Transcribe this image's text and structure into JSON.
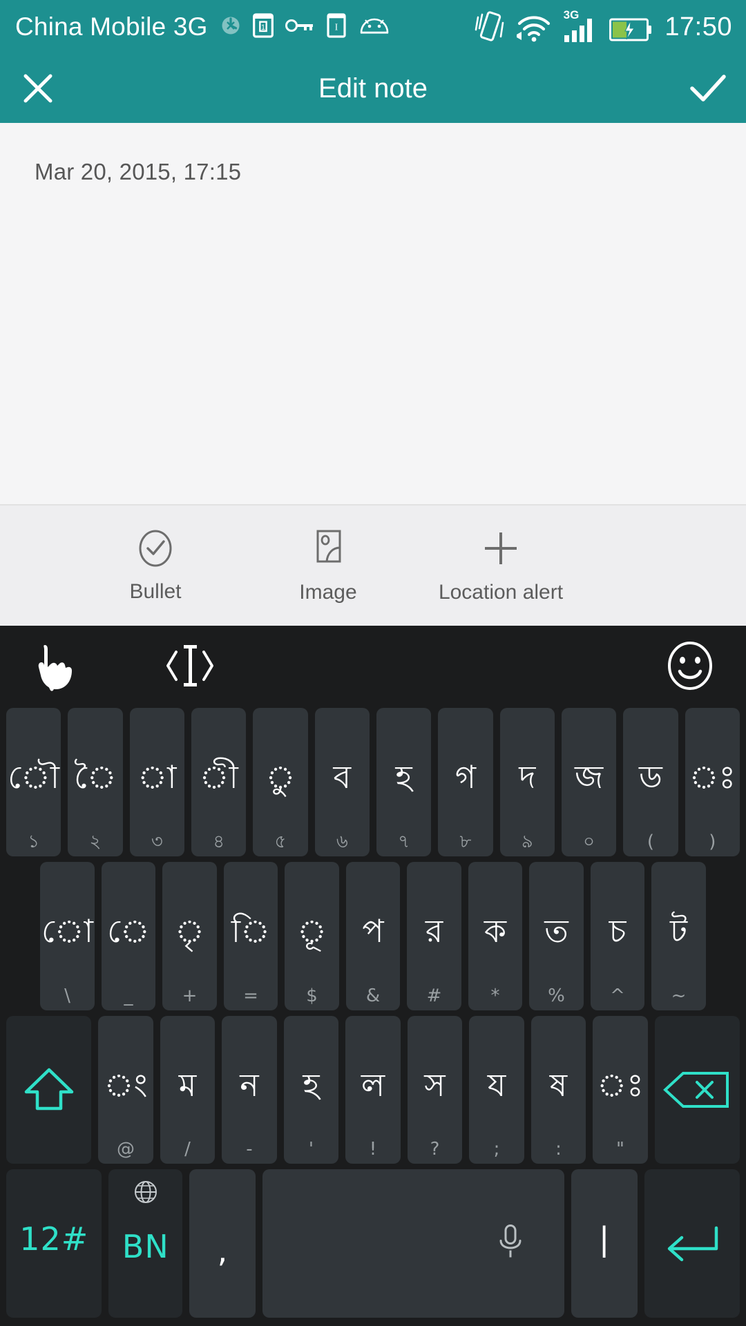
{
  "statusbar": {
    "carrier": "China Mobile 3G",
    "network_type": "3G",
    "time": "17:50",
    "icons": [
      "dnd-icon",
      "sim-card-1-icon",
      "vpn-key-icon",
      "sd-card-icon",
      "android-robot-icon",
      "vibrate-icon",
      "wifi-icon",
      "signal-bars-icon",
      "battery-charging-icon"
    ]
  },
  "appbar": {
    "title": "Edit note",
    "close_label": "✕",
    "save_label": "✓"
  },
  "note": {
    "timestamp": "Mar 20, 2015, 17:15",
    "body_text": "",
    "body_placeholder": ""
  },
  "action_bar": {
    "items": [
      {
        "label": "Bullet",
        "icon": "check-circle-icon"
      },
      {
        "label": "Image",
        "icon": "photo-icon"
      },
      {
        "label": "Location alert",
        "icon": "plus-icon"
      }
    ]
  },
  "keyboard": {
    "language": "BN",
    "accent_color": "#2fe0c8",
    "toolbar": [
      {
        "icon": "handwriting-icon"
      },
      {
        "icon": "cursor-move-icon"
      },
      {
        "icon": "emoji-icon"
      }
    ],
    "rows": [
      [
        {
          "main": "ৌ",
          "sub": "১"
        },
        {
          "main": "ৈ",
          "sub": "২"
        },
        {
          "main": "া",
          "sub": "৩"
        },
        {
          "main": "ী",
          "sub": "৪"
        },
        {
          "main": "ু",
          "sub": "৫"
        },
        {
          "main": "ব",
          "sub": "৬"
        },
        {
          "main": "হ",
          "sub": "৭"
        },
        {
          "main": "গ",
          "sub": "৮"
        },
        {
          "main": "দ",
          "sub": "৯"
        },
        {
          "main": "জ",
          "sub": "০"
        },
        {
          "main": "ড",
          "sub": "("
        },
        {
          "main": "ঃ",
          "sub": ")"
        }
      ],
      [
        {
          "main": "ো",
          "sub": "\\"
        },
        {
          "main": "ে",
          "sub": "_"
        },
        {
          "main": "ৃ",
          "sub": "+"
        },
        {
          "main": "ি",
          "sub": "="
        },
        {
          "main": "ূ",
          "sub": "$"
        },
        {
          "main": "প",
          "sub": "&"
        },
        {
          "main": "র",
          "sub": "#"
        },
        {
          "main": "ক",
          "sub": "*"
        },
        {
          "main": "ত",
          "sub": "%"
        },
        {
          "main": "চ",
          "sub": "^"
        },
        {
          "main": "ট",
          "sub": "~"
        }
      ],
      [
        {
          "main": "ং",
          "sub": "@"
        },
        {
          "main": "ম",
          "sub": "/"
        },
        {
          "main": "ন",
          "sub": "-"
        },
        {
          "main": "হ",
          "sub": "'"
        },
        {
          "main": "ল",
          "sub": "!"
        },
        {
          "main": "স",
          "sub": "?"
        },
        {
          "main": "য",
          "sub": ";"
        },
        {
          "main": "ষ",
          "sub": ":"
        },
        {
          "main": "ঃ",
          "sub": "\""
        }
      ],
      [
        {
          "main": "12#",
          "name": "symbols-key"
        },
        {
          "main": "BN",
          "name": "language-key"
        },
        {
          "main": ",",
          "name": "comma-key"
        },
        {
          "main": "",
          "name": "space-key"
        },
        {
          "main": "|",
          "name": "pipe-key"
        },
        {
          "main": "",
          "name": "enter-key"
        }
      ]
    ],
    "shift_label": "shift-icon",
    "backspace_label": "backspace-icon"
  }
}
